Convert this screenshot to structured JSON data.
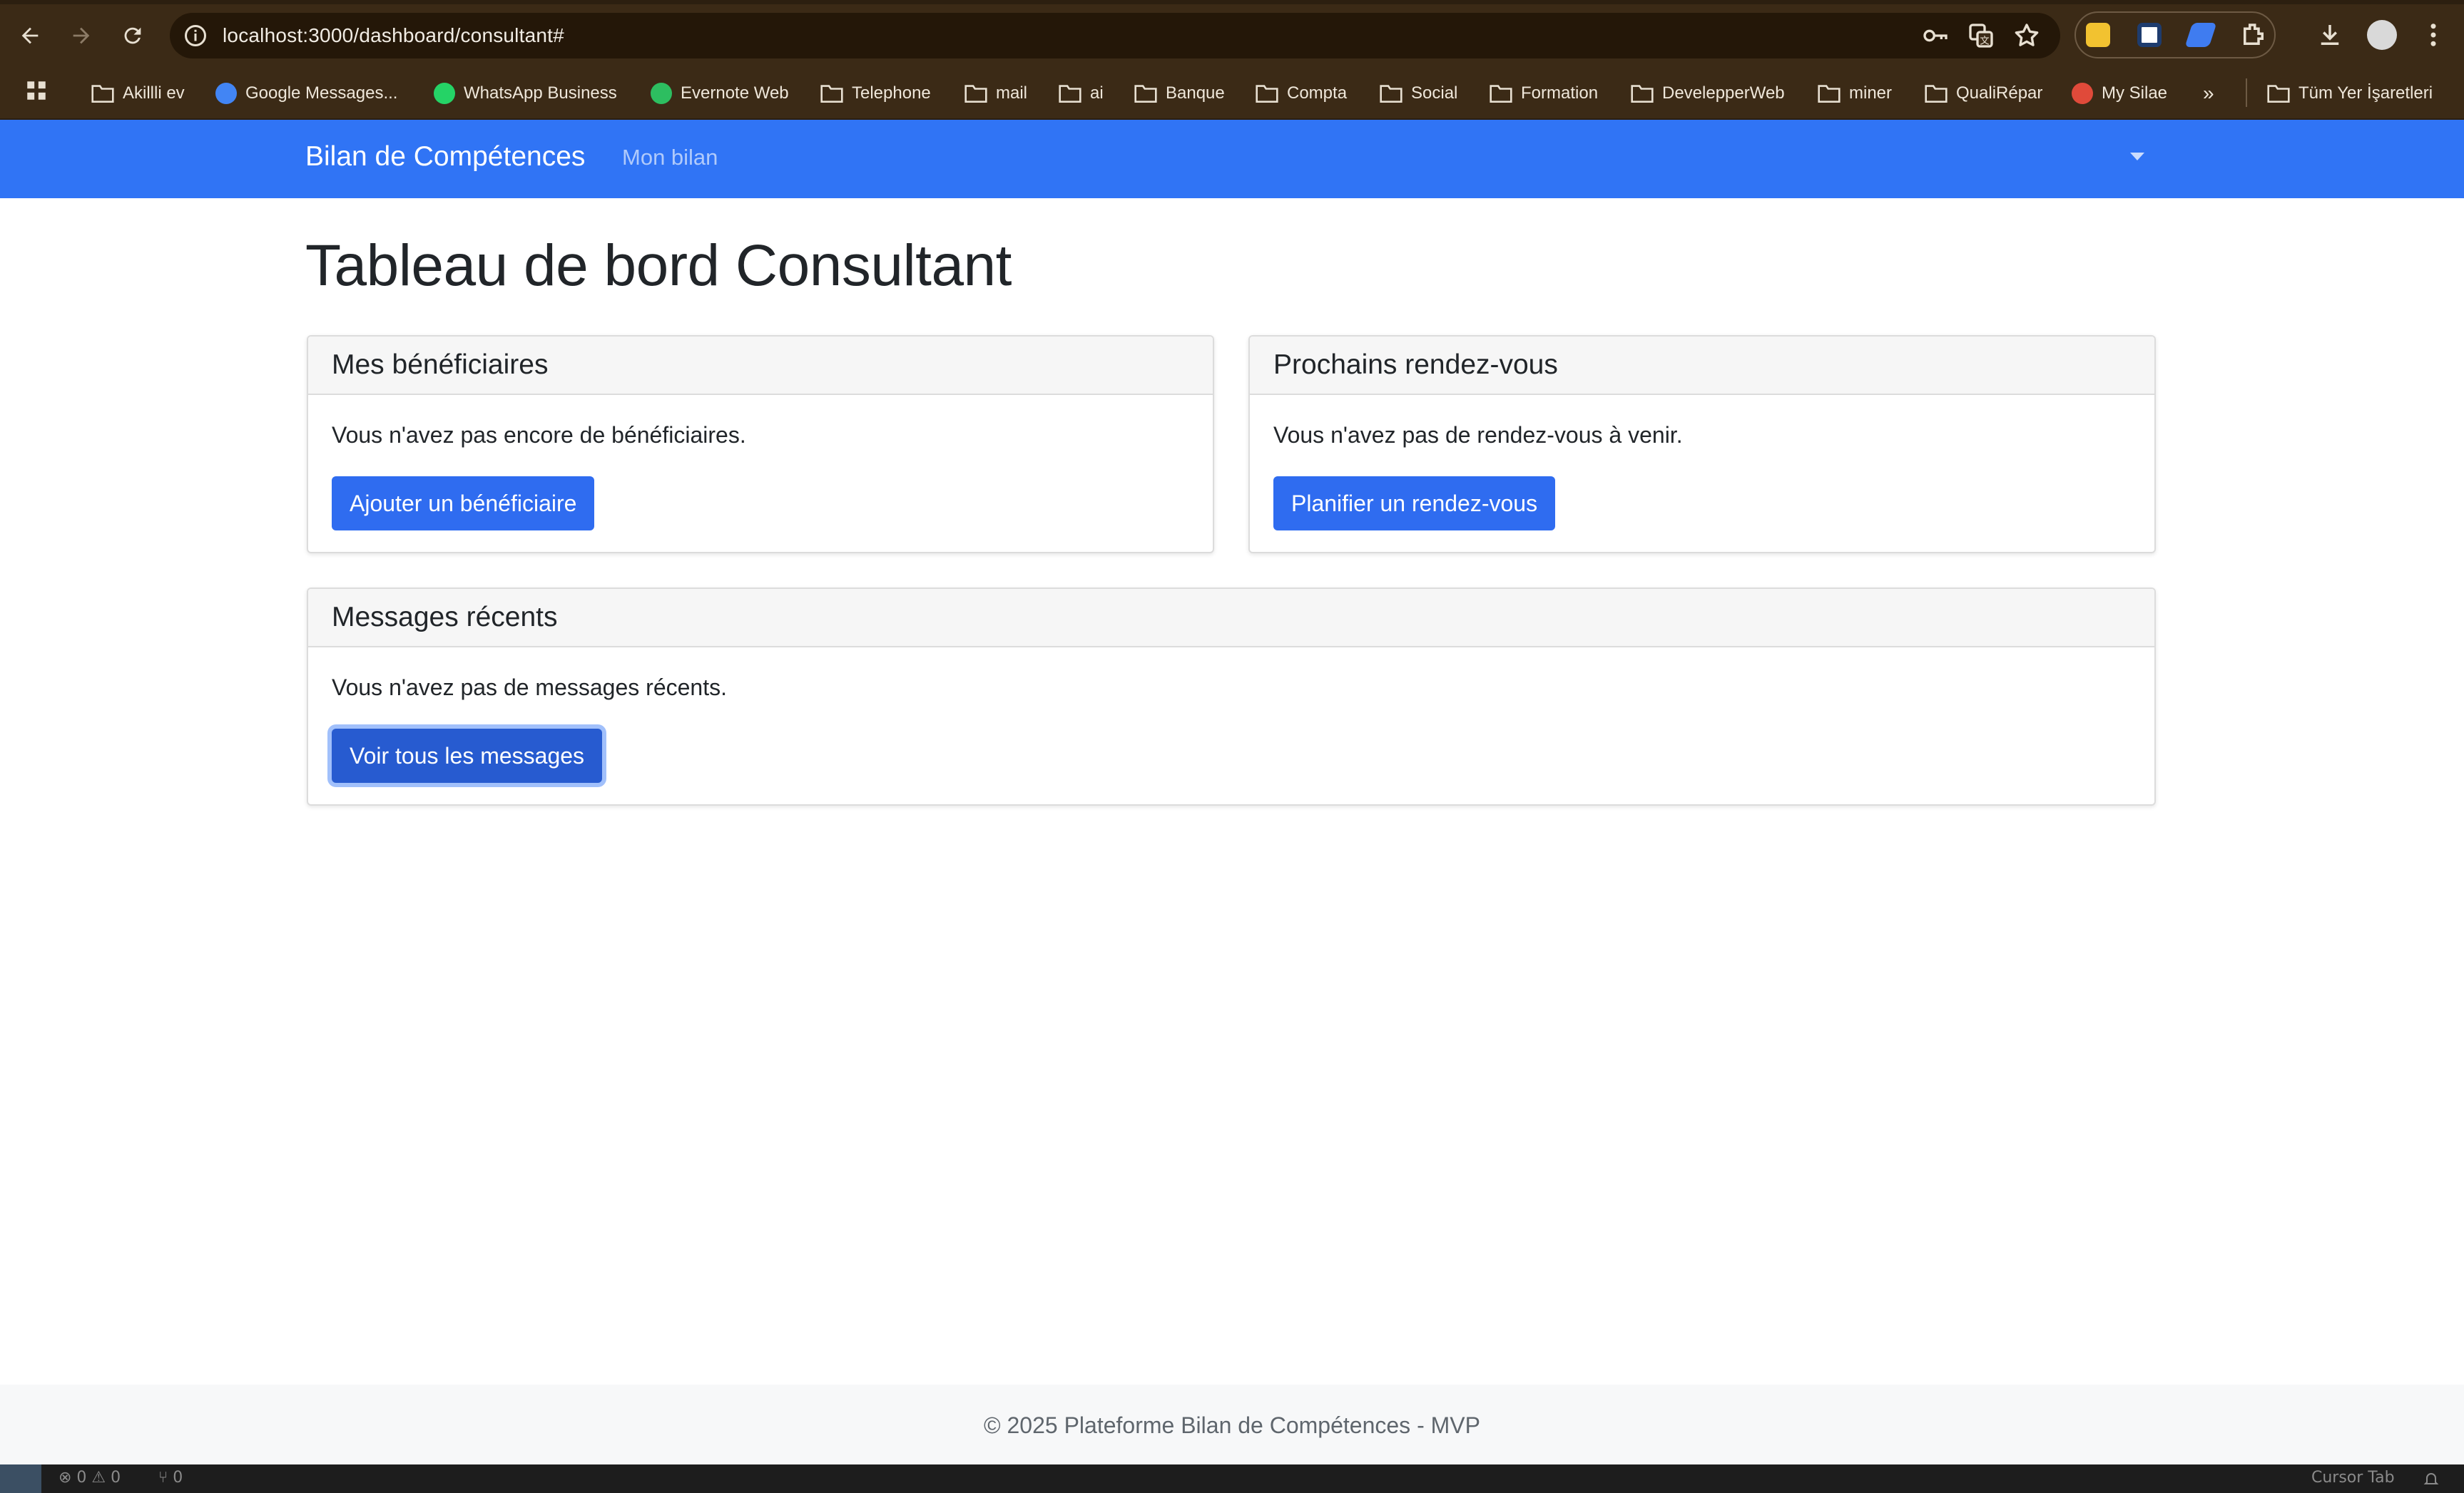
{
  "browser": {
    "url": "localhost:3000/dashboard/consultant#",
    "bookmarks": [
      {
        "label": "Akillli ev",
        "icon": "folder-icon"
      },
      {
        "label": "Google Messages...",
        "icon": "google-messages-icon"
      },
      {
        "label": "WhatsApp Business",
        "icon": "whatsapp-icon"
      },
      {
        "label": "Evernote Web",
        "icon": "evernote-icon"
      },
      {
        "label": "Telephone",
        "icon": "folder-icon"
      },
      {
        "label": "mail",
        "icon": "folder-icon"
      },
      {
        "label": "ai",
        "icon": "folder-icon"
      },
      {
        "label": "Banque",
        "icon": "folder-icon"
      },
      {
        "label": "Compta",
        "icon": "folder-icon"
      },
      {
        "label": "Social",
        "icon": "folder-icon"
      },
      {
        "label": "Formation",
        "icon": "folder-icon"
      },
      {
        "label": "DevelepperWeb",
        "icon": "folder-icon"
      },
      {
        "label": "miner",
        "icon": "folder-icon"
      },
      {
        "label": "QualiRépar",
        "icon": "folder-icon"
      },
      {
        "label": "My Silae",
        "icon": "silae-icon"
      }
    ],
    "all_bookmarks": "Tüm Yer İşaretleri",
    "overflow": "»"
  },
  "navbar": {
    "brand": "Bilan de Compétences",
    "link": "Mon bilan"
  },
  "page": {
    "title": "Tableau de bord Consultant"
  },
  "cards": {
    "beneficiaires": {
      "header": "Mes bénéficiaires",
      "text": "Vous n'avez pas encore de bénéficiaires.",
      "button": "Ajouter un bénéficiaire"
    },
    "rendezvous": {
      "header": "Prochains rendez-vous",
      "text": "Vous n'avez pas de rendez-vous à venir.",
      "button": "Planifier un rendez-vous"
    },
    "messages": {
      "header": "Messages récents",
      "text": "Vous n'avez pas de messages récents.",
      "button": "Voir tous les messages"
    }
  },
  "footer": {
    "text": "© 2025 Plateforme Bilan de Compétences - MVP"
  },
  "statusbar": {
    "problems": "⊗ 0 ⚠ 0",
    "ports": "⑂ 0",
    "right": "Cursor Tab"
  },
  "colors": {
    "navbar": "#3074f5",
    "primary_button": "#2f6cf0",
    "chrome": "#3b2a16"
  }
}
